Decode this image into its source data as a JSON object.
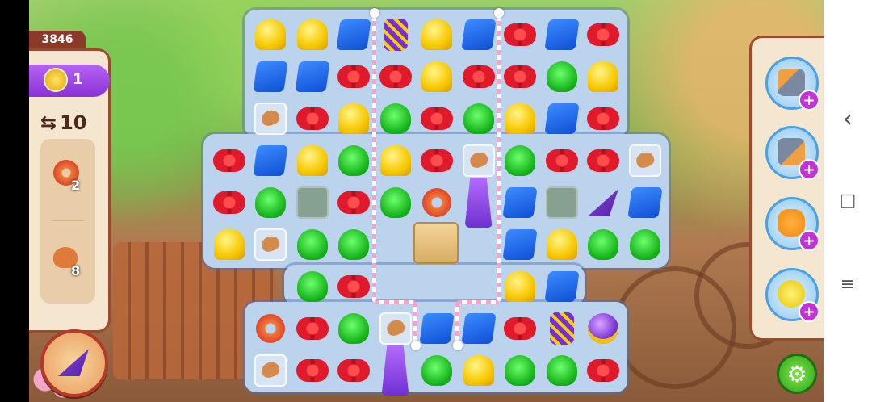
{
  "score": "3846",
  "coins": "1",
  "moves": "10",
  "goals": [
    {
      "icon": "donut-icon",
      "count": "2"
    },
    {
      "icon": "croissant-icon",
      "count": "8"
    }
  ],
  "boosters": [
    {
      "name": "hammer-booster",
      "icon": "hammer-icon"
    },
    {
      "name": "double-hammer-booster",
      "icon": "mallet-icon"
    },
    {
      "name": "glove-booster",
      "icon": "glove-icon"
    },
    {
      "name": "soap-booster",
      "icon": "soap-icon"
    }
  ],
  "navbar": {
    "back": "‹",
    "home": "□",
    "menu": "≡"
  },
  "colors": {
    "panel": "#f4e6cf",
    "border": "#9b4a30",
    "board": "#bcd3ee",
    "accent": "#8a32d6"
  }
}
